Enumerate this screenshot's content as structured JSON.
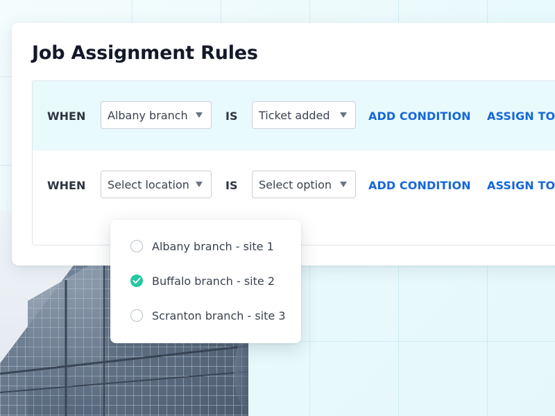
{
  "card": {
    "title": "Job Assignment Rules"
  },
  "rules": [
    {
      "when_label": "WHEN",
      "location": "Albany branch",
      "is_label": "IS",
      "option": "Ticket added",
      "add_condition": "ADD CONDITION",
      "assign_to": "ASSIGN TO"
    },
    {
      "when_label": "WHEN",
      "location_placeholder": "Select location",
      "is_label": "IS",
      "option_placeholder": "Select option",
      "add_condition": "ADD CONDITION",
      "assign_to": "ASSIGN TO"
    }
  ],
  "dropdown": {
    "options": [
      {
        "label": "Albany branch - site 1",
        "selected": false
      },
      {
        "label": "Buffalo branch - site 2",
        "selected": true
      },
      {
        "label": "Scranton branch - site 3",
        "selected": false
      }
    ]
  },
  "icons": {
    "caret": "chevron-down-icon",
    "check": "check-icon"
  },
  "colors": {
    "accent_link": "#1667d9",
    "active_row_bg": "#e8fafb",
    "check_green": "#24c8a0",
    "title": "#14192a"
  }
}
